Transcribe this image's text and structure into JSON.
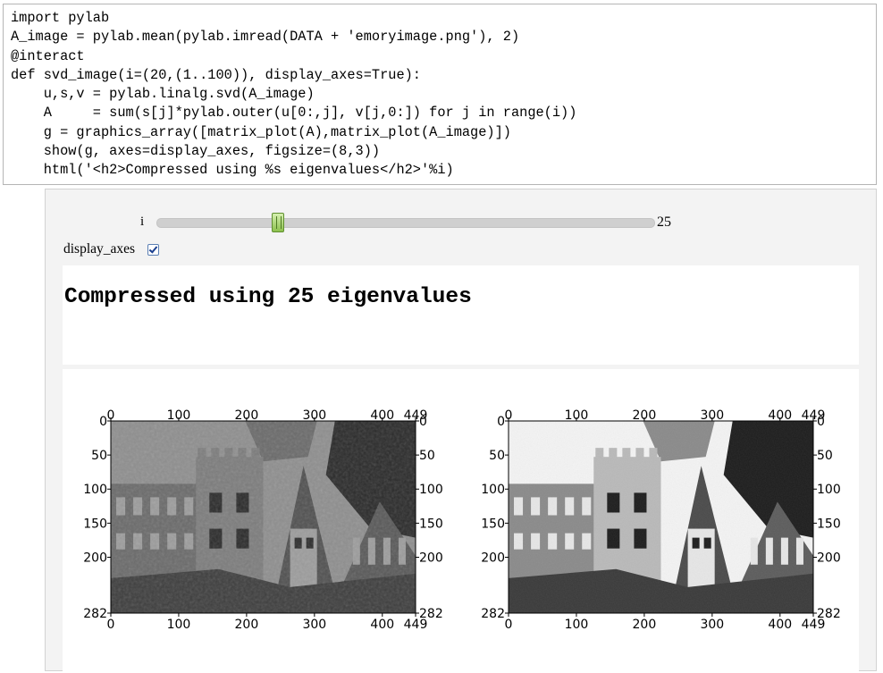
{
  "code_cell": {
    "lines": [
      "import pylab",
      "A_image = pylab.mean(pylab.imread(DATA + 'emoryimage.png'), 2)",
      "@interact",
      "def svd_image(i=(20,(1..100)), display_axes=True):",
      "    u,s,v = pylab.linalg.svd(A_image)",
      "    A     = sum(s[j]*pylab.outer(u[0:,j], v[j,0:]) for j in range(i))",
      "    g = graphics_array([matrix_plot(A),matrix_plot(A_image)])",
      "    show(g, axes=display_axes, figsize=(8,3))",
      "    html('<h2>Compressed using %s eigenvalues</h2>'%i)"
    ]
  },
  "interact": {
    "slider": {
      "label": "i",
      "value": "25",
      "min": 1,
      "max": 100,
      "position": 25
    },
    "checkbox": {
      "label": "display_axes",
      "checked": true
    }
  },
  "html_output": {
    "heading": "Compressed using 25 eigenvalues"
  },
  "plots": {
    "x_ticks": [
      "0",
      "100",
      "200",
      "300",
      "400",
      "449"
    ],
    "y_ticks": [
      "0",
      "50",
      "100",
      "150",
      "200",
      "282"
    ],
    "left_title": "matrix_plot(A)",
    "right_title": "matrix_plot(A_image)"
  },
  "colors": {
    "slider_thumb": "#8cc04e",
    "output_bg": "#f3f3f3"
  }
}
